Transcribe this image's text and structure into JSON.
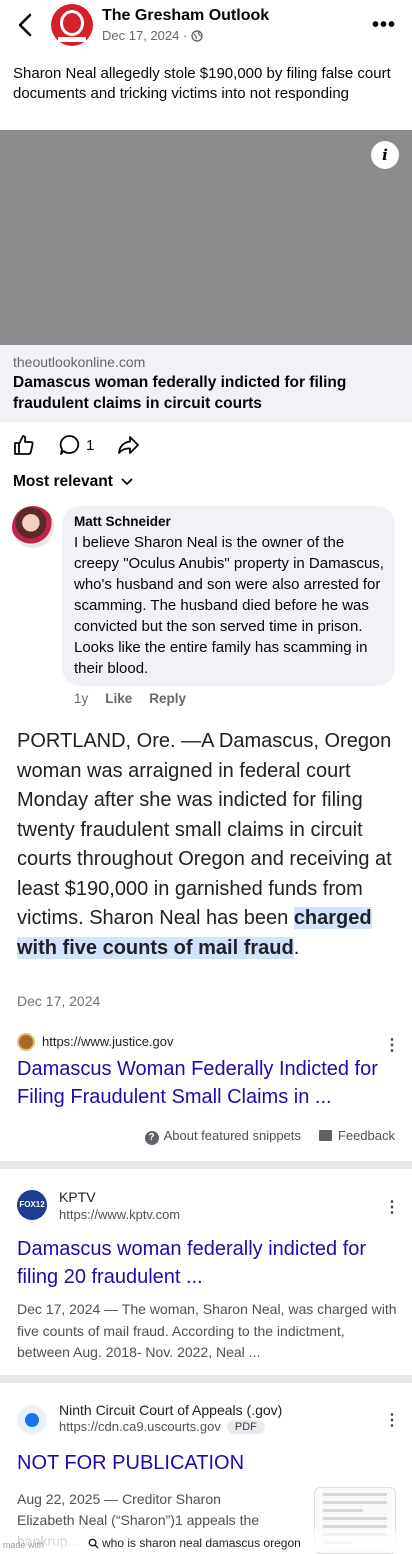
{
  "post": {
    "page_name": "The Gresham Outlook",
    "date": "Dec 17, 2024 ·",
    "caption": "Sharon Neal allegedly stole $190,000 by filing false court documents and tricking victims into not responding",
    "link_domain": "theoutlookonline.com",
    "link_title": "Damascus woman federally indicted for filing fraudulent claims in circuit courts",
    "comment_count": "1"
  },
  "comments": {
    "sort_label": "Most relevant",
    "items": [
      {
        "author": "Matt Schneider",
        "text": "I believe Sharon Neal is the owner of the creepy \"Oculus Anubis\" property in Damascus, who's husband and son were also arrested for scamming.  The husband died before he was convicted but the son served time in prison.  Looks like the entire family has scamming in their blood.",
        "age": "1y",
        "like_label": "Like",
        "reply_label": "Reply"
      }
    ]
  },
  "google": {
    "snippet_text": "PORTLAND, Ore. —A Damascus, Oregon woman was arraigned in federal court Monday after she was indicted for filing twenty fraudulent small claims in circuit courts throughout Oregon and receiving at least $190,000 in garnished funds from victims. Sharon Neal has been ",
    "snippet_highlight": "charged with five counts of mail fraud",
    "snippet_end": ".",
    "snippet_date": "Dec 17, 2024",
    "featured": {
      "url": "https://www.justice.gov",
      "title": "Damascus Woman Federally Indicted for Filing Fraudulent Small Claims in ...",
      "about_label": "About featured snippets",
      "feedback_label": "Feedback"
    },
    "results": [
      {
        "source": "KPTV",
        "url": "https://www.kptv.com",
        "favicon_text": "FOX12",
        "title": "Damascus woman federally indicted for filing 20 fraudulent ...",
        "snippet": "Dec 17, 2024 — The woman, Sharon Neal, was charged with five counts of mail fraud. According to the indictment, between Aug. 2018- Nov. 2022, Neal ..."
      },
      {
        "source": "Ninth Circuit Court of Appeals (.gov)",
        "url": "https://cdn.ca9.uscourts.gov",
        "badge": "PDF",
        "title": "NOT FOR PUBLICATION",
        "snippet": "Aug 22, 2025 — Creditor Sharon Elizabeth Neal (“Sharon”)1 appeals the bankrup..."
      }
    ],
    "search_query": "who is sharon neal damascus oregon",
    "watermark": "made with"
  },
  "colors": {
    "link_blue": "#1a0dab",
    "highlight": "#d3e3fd",
    "bubble": "#f0f2f5",
    "logo_red": "#d3202a"
  }
}
